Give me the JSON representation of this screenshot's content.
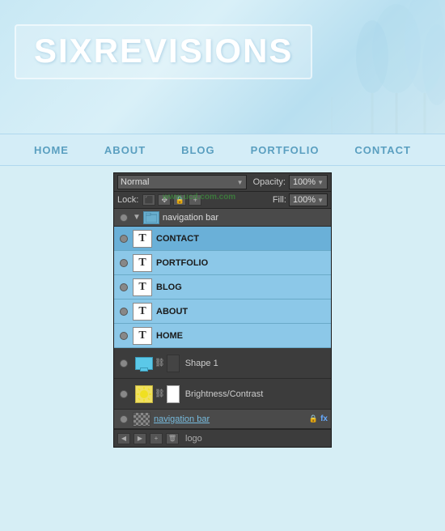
{
  "banner": {
    "logo": "SIXREVISIONS"
  },
  "navbar": {
    "items": [
      {
        "label": "HOME"
      },
      {
        "label": "ABOUT"
      },
      {
        "label": "BLOG"
      },
      {
        "label": "PORTFOLIO"
      },
      {
        "label": "CONTACT"
      }
    ]
  },
  "ps_panel": {
    "blend_mode": "Normal",
    "opacity_label": "Opacity:",
    "opacity_value": "100%",
    "lock_label": "Lock:",
    "fill_label": "Fill:",
    "fill_value": "100%",
    "watermark": "www.ucd.com.com",
    "group_row": {
      "label": "navigation bar",
      "arrow": "▼"
    },
    "layers": [
      {
        "name": "CONTACT",
        "type": "text"
      },
      {
        "name": "PORTFOLIO",
        "type": "text"
      },
      {
        "name": "BLOG",
        "type": "text"
      },
      {
        "name": "ABOUT",
        "type": "text"
      },
      {
        "name": "HOME",
        "type": "text"
      }
    ],
    "shape_layers": [
      {
        "name": "Shape 1",
        "type": "shape"
      },
      {
        "name": "Brightness/Contrast",
        "type": "adjustment"
      }
    ],
    "bottom_group": {
      "label": "navigation bar",
      "lock_icon": "🔒",
      "fx": "fx"
    },
    "footer": {
      "layer_label": "logo"
    }
  }
}
